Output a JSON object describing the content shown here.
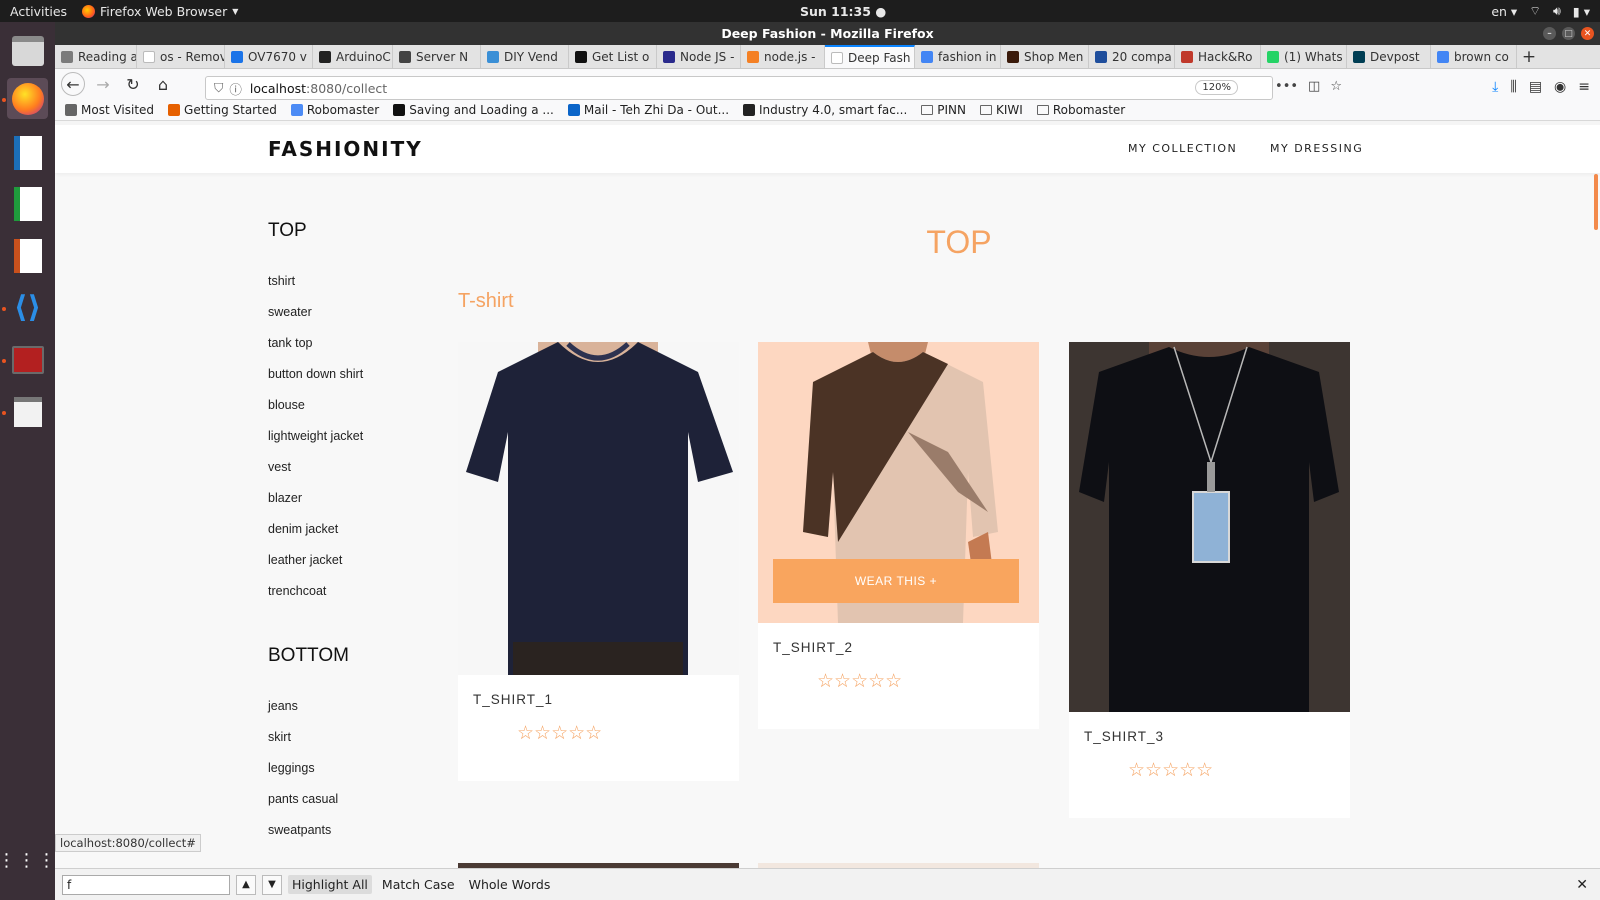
{
  "desktop": {
    "activities": "Activities",
    "app_name": "Firefox Web Browser",
    "clock": "Sun 11:35",
    "lang": "en",
    "dock_apps": [
      "files-icon",
      "firefox-icon",
      "writer-icon",
      "calc-icon",
      "impress-icon",
      "vscode-icon",
      "terminal-icon",
      "text-editor-icon",
      "app-grid-icon"
    ]
  },
  "window": {
    "title": "Deep Fashion - Mozilla Firefox"
  },
  "tabs": [
    {
      "label": "Reading a",
      "color": "#7b7b7b"
    },
    {
      "label": "os - Remove",
      "color": "#ffffff"
    },
    {
      "label": "OV7670 v",
      "color": "#1a73e8"
    },
    {
      "label": "ArduinoC",
      "color": "#222222"
    },
    {
      "label": "Server N",
      "color": "#444444"
    },
    {
      "label": "DIY Vend",
      "color": "#3a8fd6"
    },
    {
      "label": "Get List o",
      "color": "#111111"
    },
    {
      "label": "Node JS -",
      "color": "#2a2a8c"
    },
    {
      "label": "node.js -",
      "color": "#f48024"
    },
    {
      "label": "Deep Fash",
      "color": "#ffffff",
      "active": true
    },
    {
      "label": "fashion in",
      "color": "#4285f4"
    },
    {
      "label": "Shop Men",
      "color": "#3a1a0a"
    },
    {
      "label": "20 compa",
      "color": "#1f4e9c"
    },
    {
      "label": "Hack&Ro",
      "color": "#c0392b"
    },
    {
      "label": "(1) Whats",
      "color": "#25d366"
    },
    {
      "label": "Devpost",
      "color": "#003e54"
    },
    {
      "label": "brown co",
      "color": "#4285f4"
    }
  ],
  "urlbar": {
    "host": "localhost",
    "path": ":8080/collect",
    "zoom": "120%"
  },
  "bookmarks": [
    {
      "label": "Most Visited",
      "color": "#666666"
    },
    {
      "label": "Getting Started",
      "color": "#e66000"
    },
    {
      "label": "Robomaster",
      "color": "#4c8bf5"
    },
    {
      "label": "Saving and Loading a ...",
      "color": "#111111"
    },
    {
      "label": "Mail - Teh Zhi Da - Out...",
      "color": "#0a64c8"
    },
    {
      "label": "Industry 4.0, smart fac...",
      "color": "#222222"
    },
    {
      "label": "PINN",
      "color": "folder"
    },
    {
      "label": "KIWI",
      "color": "folder"
    },
    {
      "label": "Robomaster",
      "color": "folder"
    }
  ],
  "site": {
    "logo": "FASHIONITY",
    "nav": [
      "MY COLLECTION",
      "MY DRESSING"
    ],
    "accent": "#f5a362"
  },
  "sidebar": {
    "top_heading": "TOP",
    "top_items": [
      "tshirt",
      "sweater",
      "tank top",
      "button down shirt",
      "blouse",
      "lightweight jacket",
      "vest",
      "blazer",
      "denim jacket",
      "leather jacket",
      "trenchcoat"
    ],
    "bottom_heading": "BOTTOM",
    "bottom_items": [
      "jeans",
      "skirt",
      "leggings",
      "pants casual",
      "sweatpants"
    ]
  },
  "main": {
    "section_title": "TOP",
    "sub_title": "T-shirt",
    "wear_button": "WEAR THIS +",
    "cards": [
      {
        "name": "T_SHIRT_1",
        "rating": 0,
        "stars": "☆☆☆☆☆"
      },
      {
        "name": "T_SHIRT_2",
        "rating": 0,
        "stars": "☆☆☆☆☆"
      },
      {
        "name": "T_SHIRT_3",
        "rating": 0,
        "stars": "☆☆☆☆☆"
      }
    ]
  },
  "status_link": "localhost:8080/collect#",
  "findbar": {
    "query": "f",
    "highlight_all": "Highlight All",
    "match_case": "Match Case",
    "whole_words": "Whole Words"
  }
}
